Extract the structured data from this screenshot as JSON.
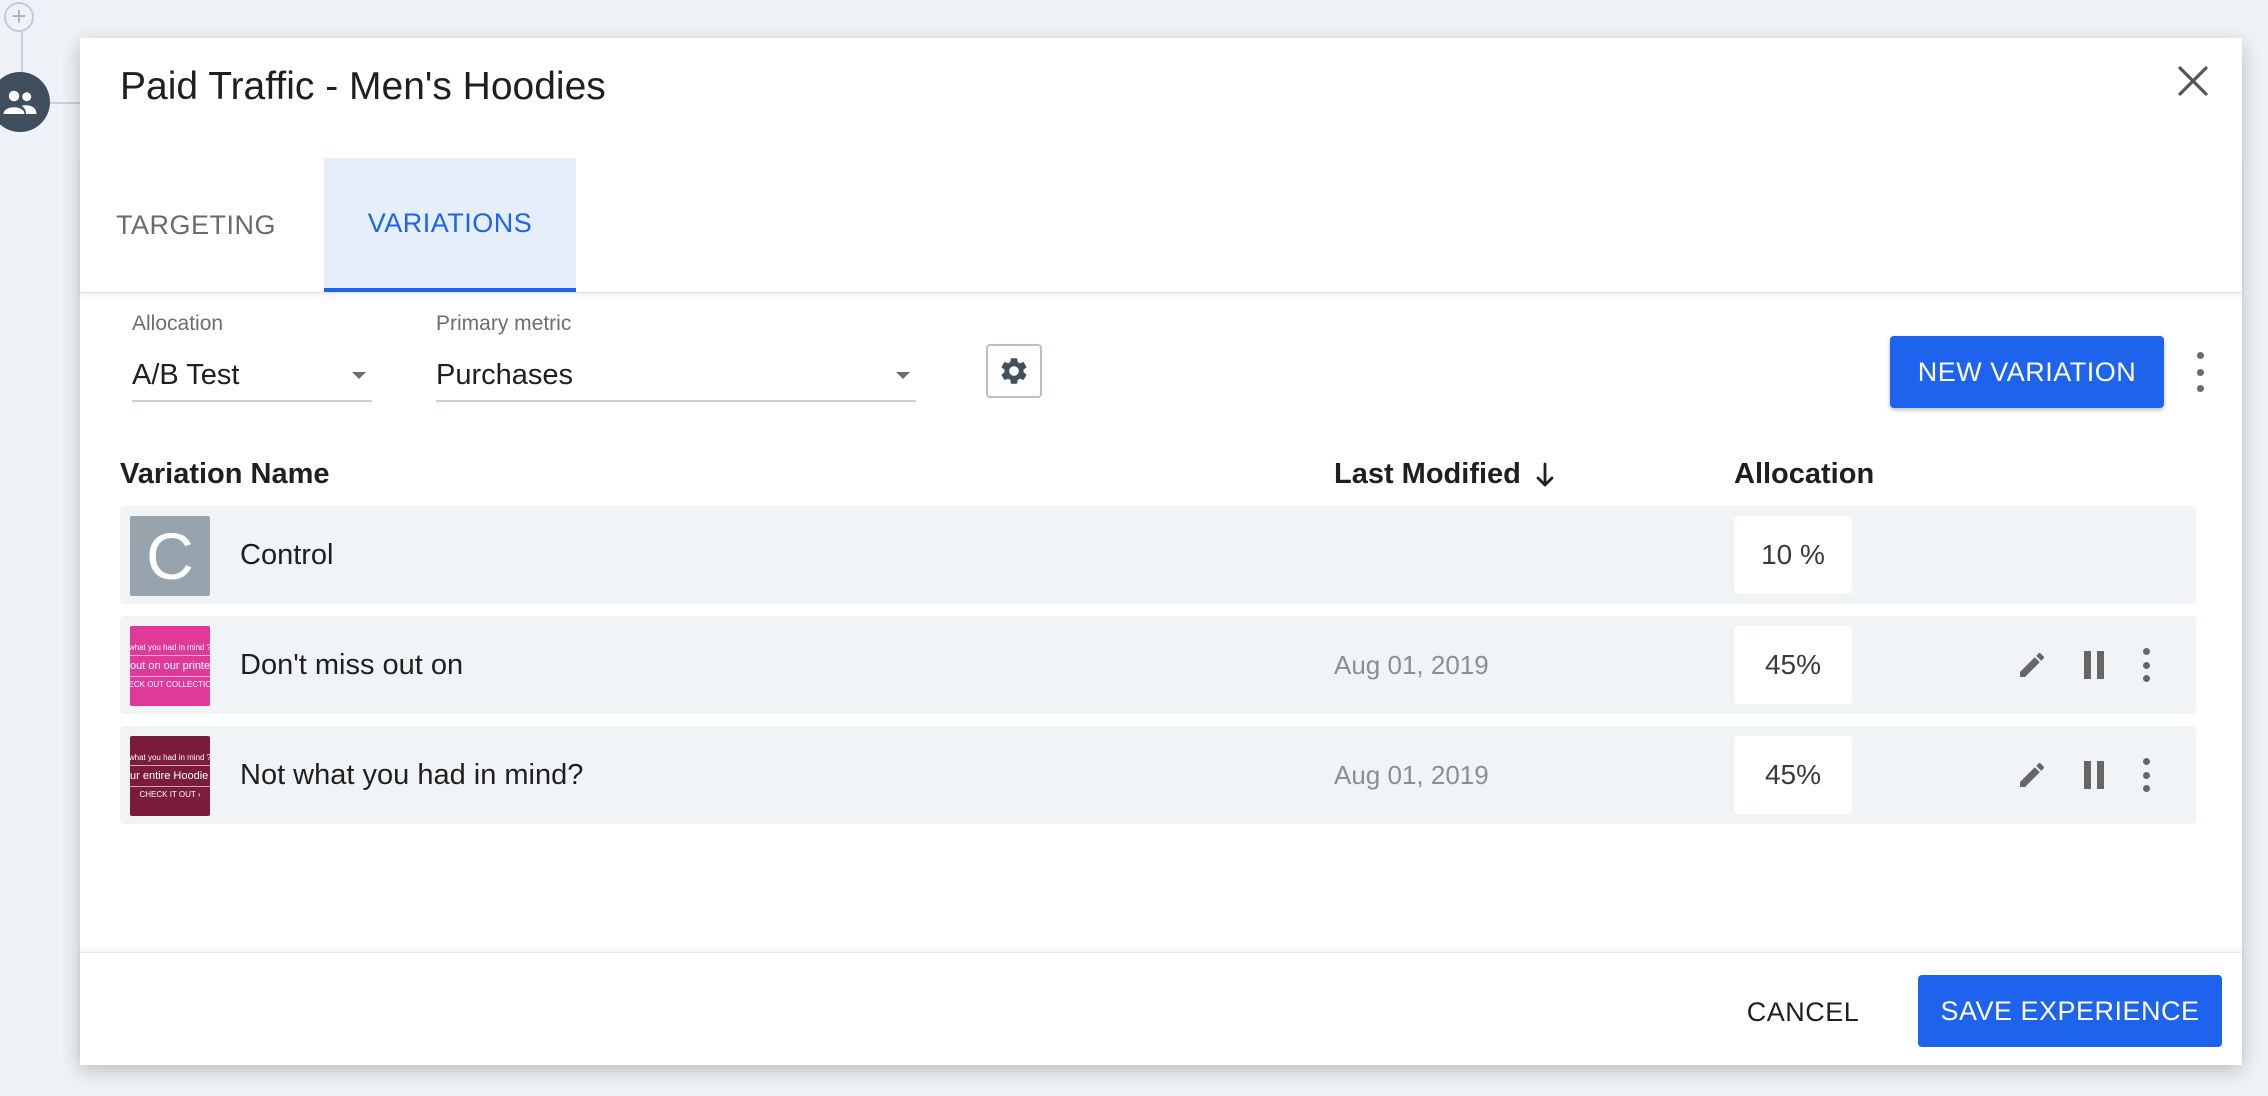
{
  "background": {
    "add_icon": "plus-circle-icon",
    "audience_icon": "users-icon"
  },
  "modal": {
    "title": "Paid Traffic - Men's Hoodies",
    "close_icon": "close-icon"
  },
  "tabs": [
    {
      "label": "TARGETING",
      "active": false
    },
    {
      "label": "VARIATIONS",
      "active": true
    }
  ],
  "controls": {
    "allocation": {
      "label": "Allocation",
      "value": "A/B Test"
    },
    "primary_metric": {
      "label": "Primary metric",
      "value": "Purchases"
    },
    "settings_icon": "gear-icon",
    "new_variation_label": "NEW VARIATION",
    "more_icon": "more-vertical-icon"
  },
  "table": {
    "headers": {
      "name": "Variation Name",
      "last_modified": "Last Modified",
      "allocation": "Allocation"
    },
    "sort_icon": "arrow-down-icon",
    "rows": [
      {
        "name": "Control",
        "thumb_letter": "C",
        "thumb_color": "#97a4ae",
        "last_modified": "",
        "allocation": "10 %"
      },
      {
        "name": "Don't miss out on",
        "thumb_color": "#e0399a",
        "thumb_lines": [
          "what you had in mind ?",
          "out on our printed",
          "ECK OUT COLLECTIO"
        ],
        "last_modified": "Aug 01, 2019",
        "allocation": "45%"
      },
      {
        "name": "Not what you had in mind?",
        "thumb_color": "#7a1c3a",
        "thumb_lines": [
          "what you had in mind ?",
          "ur entire Hoodie c",
          "CHECK IT OUT ›"
        ],
        "last_modified": "Aug 01, 2019",
        "allocation": "45%"
      }
    ],
    "row_action_icons": [
      "pencil-icon",
      "pause-icon",
      "more-vertical-icon"
    ]
  },
  "footer": {
    "cancel_label": "CANCEL",
    "save_label": "SAVE EXPERIENCE"
  },
  "colors": {
    "accent": "#1d63ed",
    "active_tab_bg": "#e5eefb",
    "row_bg": "#f1f4f7",
    "page_bg": "#eef2f6"
  }
}
